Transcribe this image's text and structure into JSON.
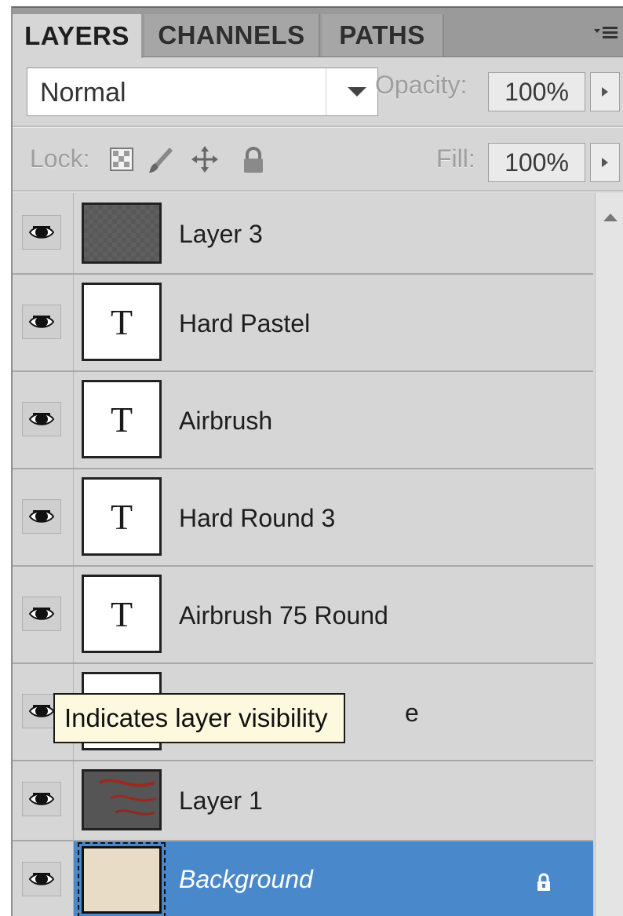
{
  "tabs": [
    {
      "label": "LAYERS",
      "active": true
    },
    {
      "label": "CHANNELS",
      "active": false
    },
    {
      "label": "PATHS",
      "active": false
    }
  ],
  "blend_mode": "Normal",
  "opacity": {
    "label": "Opacity:",
    "value": "100%"
  },
  "lock": {
    "label": "Lock:"
  },
  "fill": {
    "label": "Fill:",
    "value": "100%"
  },
  "layers": [
    {
      "name": "Layer 3",
      "type": "pixel-dark",
      "visible": true
    },
    {
      "name": "Hard Pastel",
      "type": "text",
      "visible": true
    },
    {
      "name": "Airbrush",
      "type": "text",
      "visible": true
    },
    {
      "name": "Hard Round 3",
      "type": "text",
      "visible": true
    },
    {
      "name": "Airbrush 75 Round",
      "type": "text",
      "visible": true
    },
    {
      "name": "e",
      "type": "text",
      "visible": true
    },
    {
      "name": "Layer 1",
      "type": "pixel-strokes",
      "visible": true
    },
    {
      "name": "Background",
      "type": "background",
      "visible": true,
      "selected": true,
      "locked": true
    }
  ],
  "tooltip": "Indicates layer visibility",
  "thumb_text_glyph": "T",
  "colors": {
    "selection": "#4a88cc",
    "panel": "#d6d6d6",
    "tooltip_bg": "#fdf9de"
  }
}
